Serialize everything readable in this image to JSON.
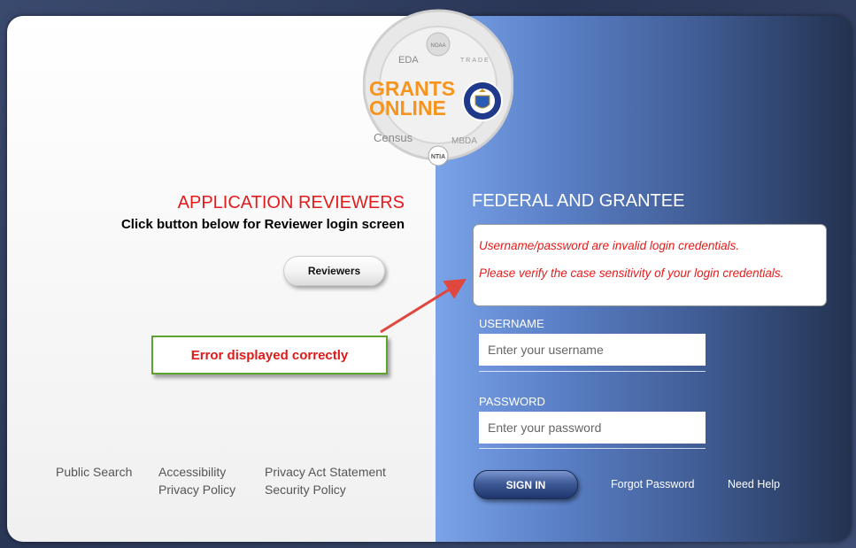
{
  "logo": {
    "lines": [
      "GRANTS",
      "ONLINE"
    ],
    "agencies": [
      "EDA",
      "NOAA",
      "TRADE",
      "Census",
      "MBDA",
      "NTIA"
    ],
    "colors": {
      "orange": "#f7941d",
      "seal_blue": "#1f3a8a"
    }
  },
  "reviewers": {
    "title": "APPLICATION REVIEWERS",
    "subtitle": "Click button below for Reviewer login screen",
    "button_label": "Reviewers"
  },
  "annotation": {
    "callout": "Error displayed correctly"
  },
  "footer": {
    "public_search": "Public Search",
    "accessibility": "Accessibility",
    "privacy_policy": "Privacy Policy",
    "privacy_act": "Privacy Act Statement",
    "security_policy": "Security Policy"
  },
  "login": {
    "title": "FEDERAL AND GRANTEE",
    "error_line1": "Username/password are invalid login credentials.",
    "error_line2": "Please verify the case sensitivity of your login credentials.",
    "username_label": "USERNAME",
    "username_placeholder": "Enter your username",
    "password_label": "PASSWORD",
    "password_placeholder": "Enter your password",
    "signin_label": "SIGN IN",
    "forgot_password": "Forgot Password",
    "need_help": "Need Help"
  },
  "colors": {
    "error_red": "#e41b1b",
    "callout_border": "#5ca333",
    "panel_blue": "#5a7fc6"
  }
}
